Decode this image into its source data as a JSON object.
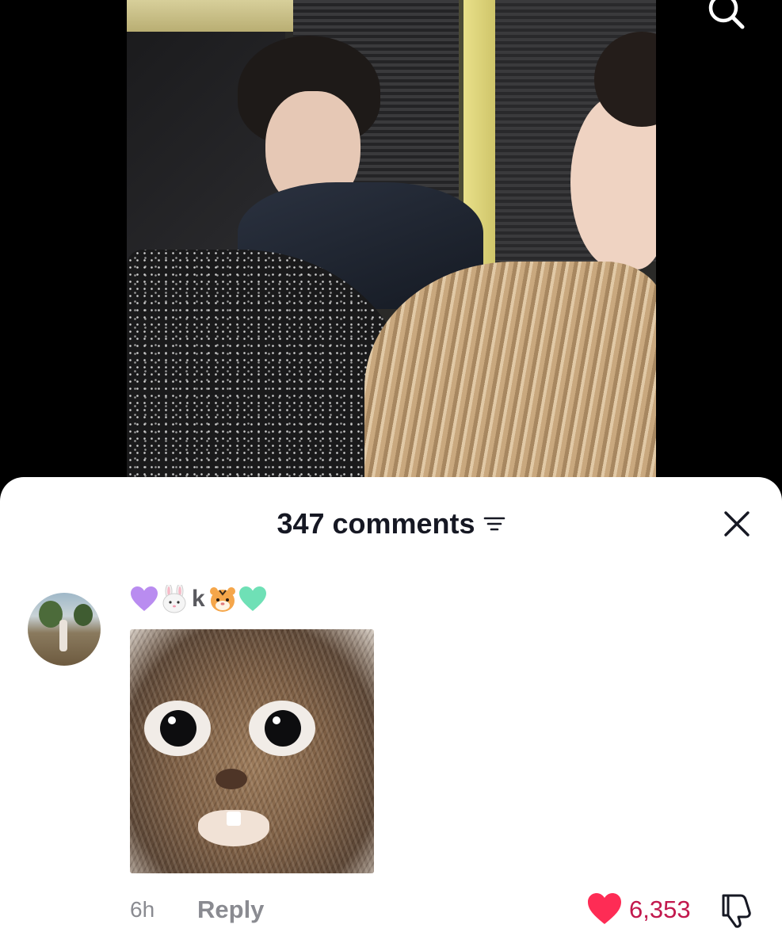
{
  "comments_sheet": {
    "title": "347 comments",
    "icons": {
      "sort": "sort-lines-icon",
      "close": "close-x-icon",
      "search": "search-icon"
    }
  },
  "comment": {
    "username": {
      "text": "k",
      "emojis": [
        "purple-heart",
        "rabbit-face",
        "tiger-face",
        "green-heart"
      ]
    },
    "sticker": "cat-surprised-sticker",
    "time": "6h",
    "reply_label": "Reply",
    "likes": "6,353",
    "liked": true
  },
  "colors": {
    "sheet_bg": "#ffffff",
    "title": "#161823",
    "muted": "#8a8b91",
    "like_red": "#fe2c55",
    "like_count": "#c2184d"
  }
}
